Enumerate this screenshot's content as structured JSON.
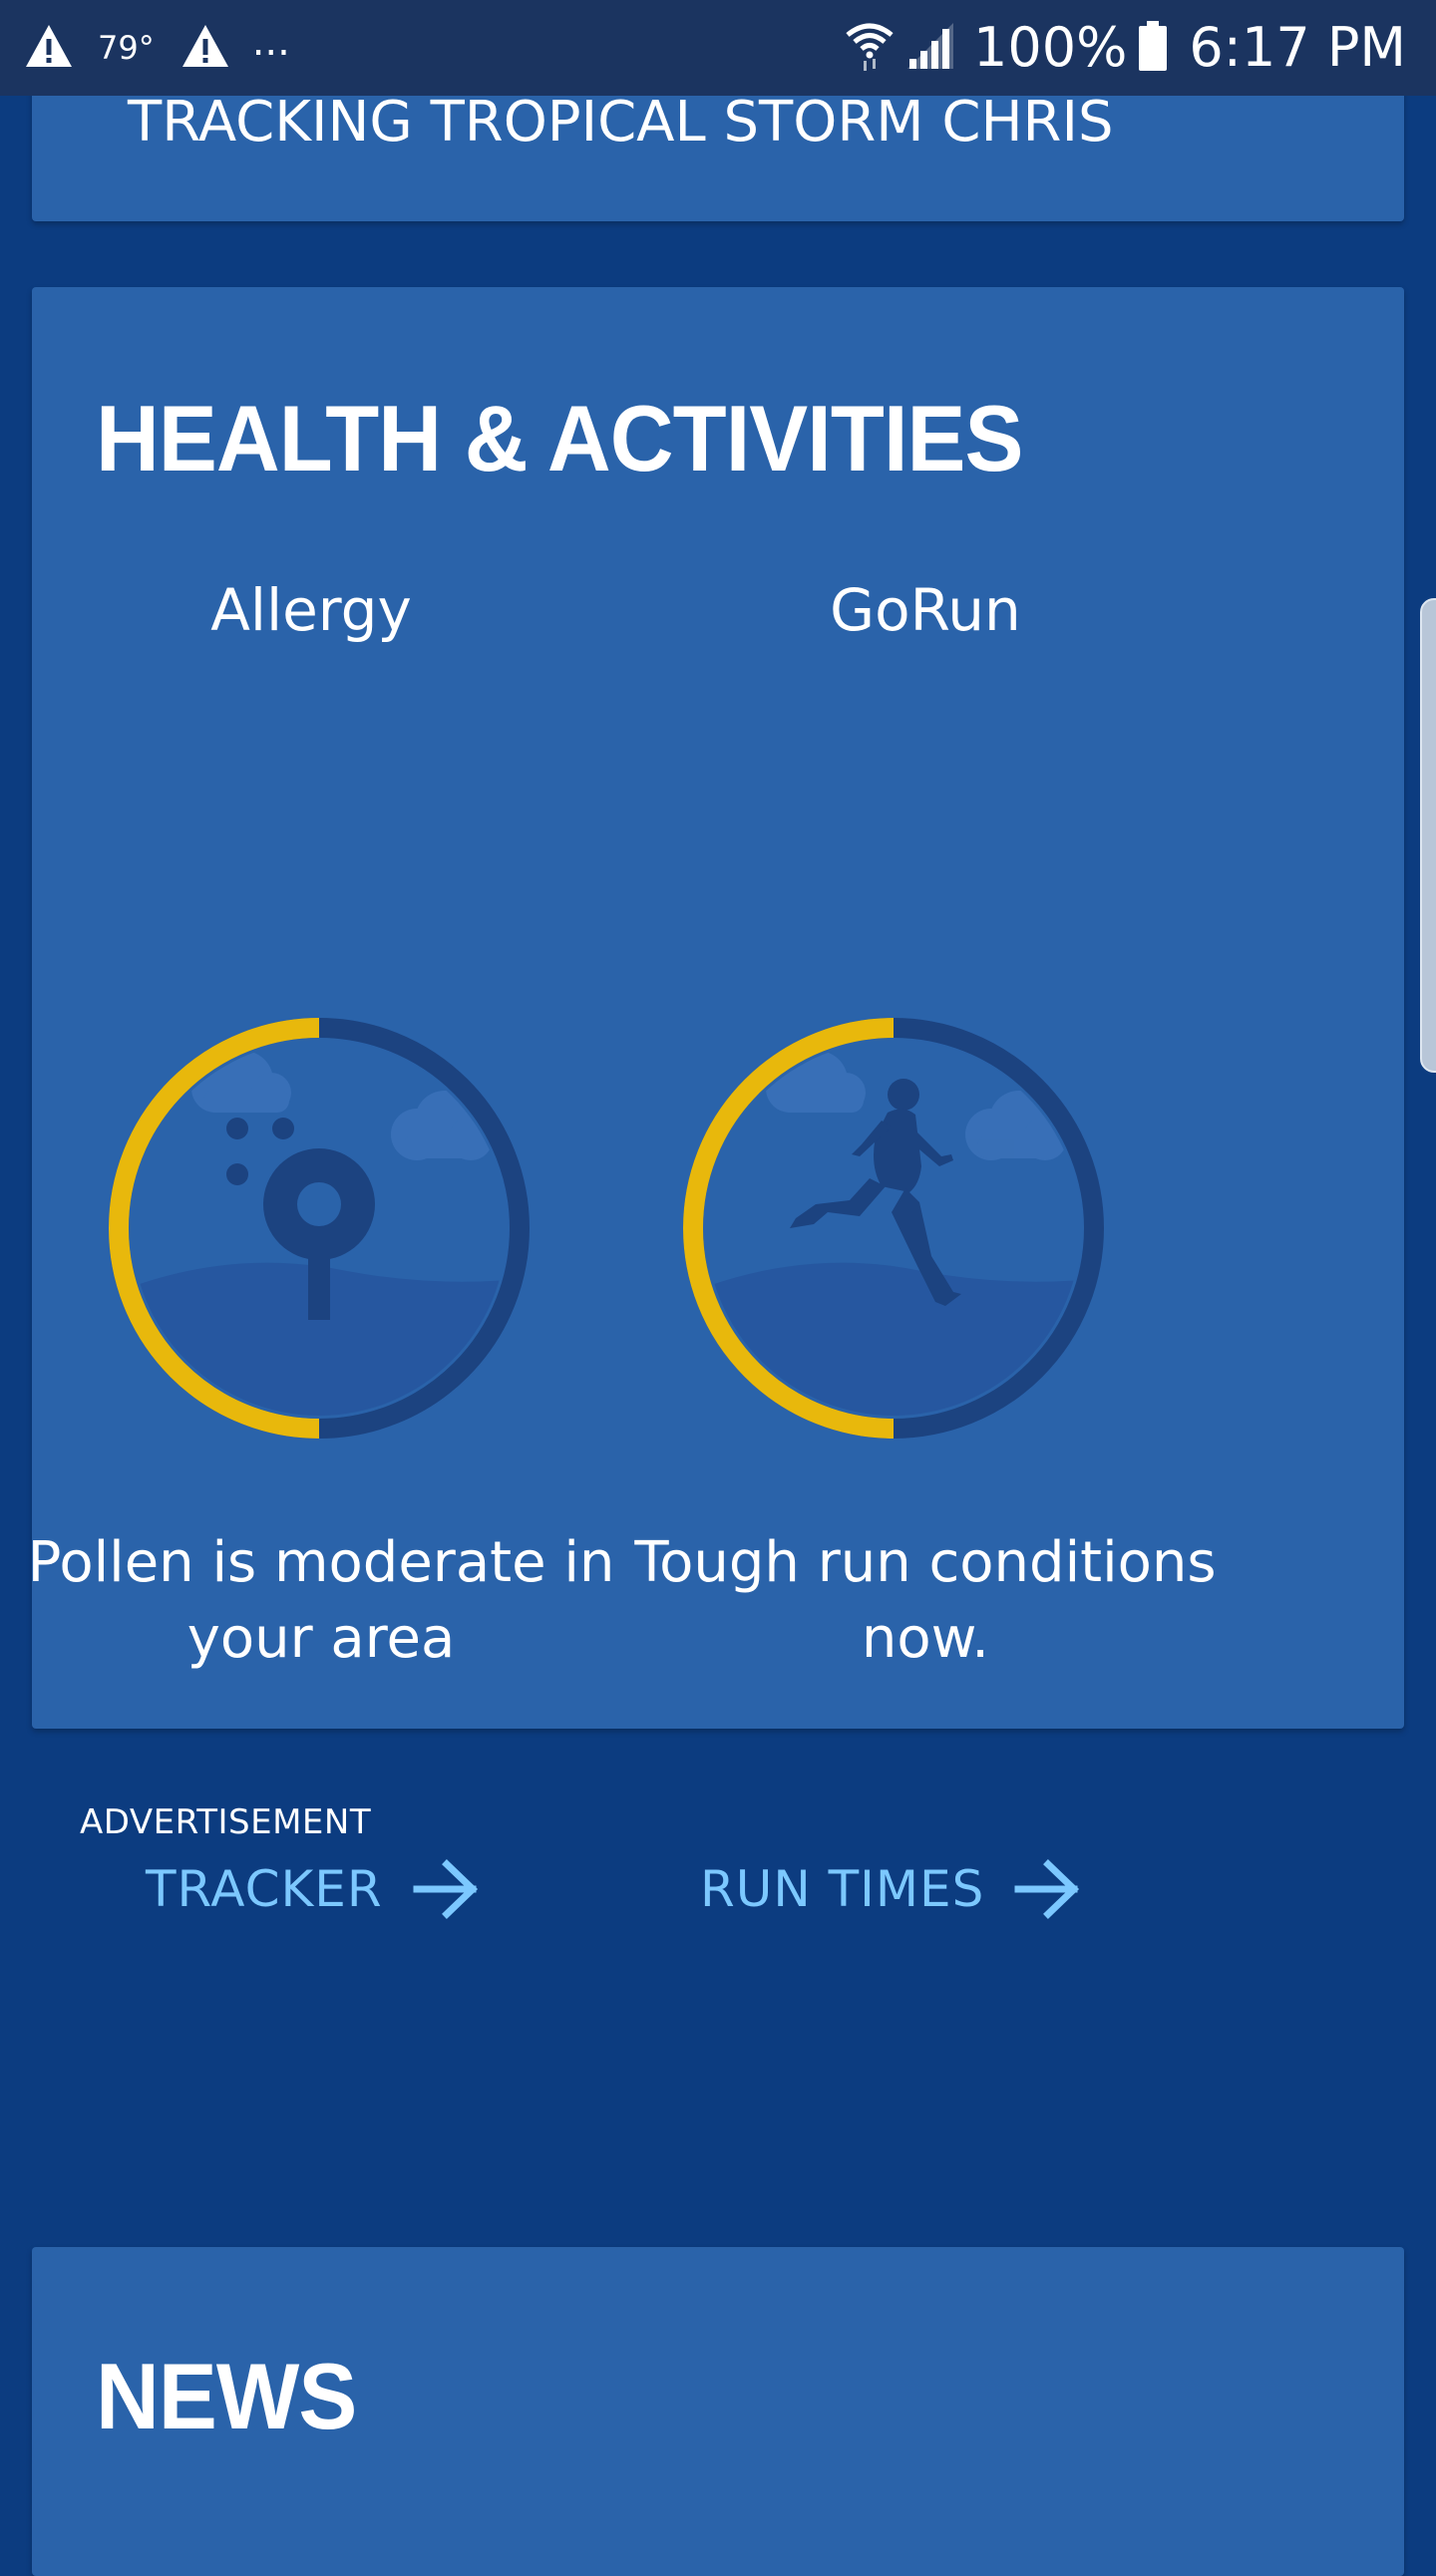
{
  "status_bar": {
    "temperature": "79°",
    "more": "...",
    "battery_percent": "100%",
    "time": "6:17 PM"
  },
  "top_card": {
    "title": "TRACKING TROPICAL STORM CHRIS"
  },
  "health": {
    "title": "HEALTH & ACTIVITIES",
    "tiles": [
      {
        "name": "Allergy",
        "description": "Pollen is moderate in your area",
        "link_label": "TRACKER",
        "level": 0.5
      },
      {
        "name": "GoRun",
        "description": "Tough run conditions now.",
        "link_label": "RUN TIMES",
        "level": 0.5
      }
    ]
  },
  "advertisement": {
    "label": "ADVERTISEMENT"
  },
  "news": {
    "title": "NEWS"
  },
  "colors": {
    "background": "#0c3c80",
    "card": "#2a63aa",
    "ring_fill": "#e8b80c",
    "ring_track": "#1c4380",
    "link": "#7cc8ff"
  },
  "icons": {
    "status_left": [
      "alert-icon",
      "alert-icon"
    ],
    "status_right": [
      "wifi-icon",
      "signal-icon",
      "battery-icon"
    ],
    "allergy_tile": "pollen-icon",
    "gorun_tile": "runner-icon",
    "link_arrow": "arrow-right-icon"
  }
}
